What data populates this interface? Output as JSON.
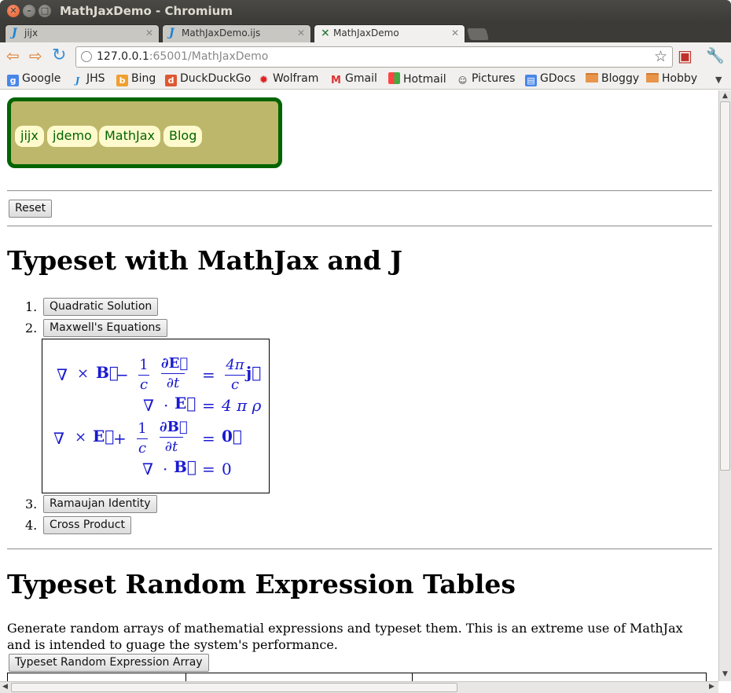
{
  "window": {
    "title": "MathJaxDemo - Chromium"
  },
  "tabs": [
    {
      "label": "jijx",
      "icon": "j-icon"
    },
    {
      "label": "MathJaxDemo.ijs",
      "icon": "j-icon"
    },
    {
      "label": "MathJaxDemo",
      "icon": "jhs-icon"
    }
  ],
  "address": {
    "host": "127.0.0.1",
    "path": ":65001/MathJaxDemo"
  },
  "bookmarks": [
    "Google",
    "JHS",
    "Bing",
    "DuckDuckGo",
    "Wolfram",
    "Gmail",
    "Hotmail",
    "Pictures",
    "GDocs",
    "Bloggy",
    "Hobby"
  ],
  "nav": {
    "links": [
      "jijx",
      "jdemo",
      "MathJax",
      "Blog"
    ]
  },
  "reset_label": "Reset",
  "section1": {
    "heading": "Typeset with MathJax and J",
    "items": [
      {
        "num": "1.",
        "label": "Quadratic Solution"
      },
      {
        "num": "2.",
        "label": "Maxwell's Equations"
      },
      {
        "num": "3.",
        "label": "Ramaujan Identity"
      },
      {
        "num": "4.",
        "label": "Cross Product"
      }
    ],
    "maxwell": {
      "nabla": "∇",
      "cross": "×",
      "dot": "·",
      "B": "B⃗",
      "E": "E⃗",
      "j": "j⃗",
      "zero_vec": "0⃗",
      "minus": "−",
      "plus": "+",
      "eq": "=",
      "one": "1",
      "c": "c",
      "dE": "∂E⃗",
      "dB": "∂B⃗",
      "dt": "∂t",
      "fourpi": "4π",
      "rhs2": "4 π ρ",
      "rhs4": "0"
    }
  },
  "section2": {
    "heading": "Typeset Random Expression Tables",
    "paragraph": "Generate random arrays of mathematial expressions and typeset them. This is an extreme use of MathJax and is intended to guage the system's performance.",
    "button_label": "Typeset Random Expression Array"
  }
}
